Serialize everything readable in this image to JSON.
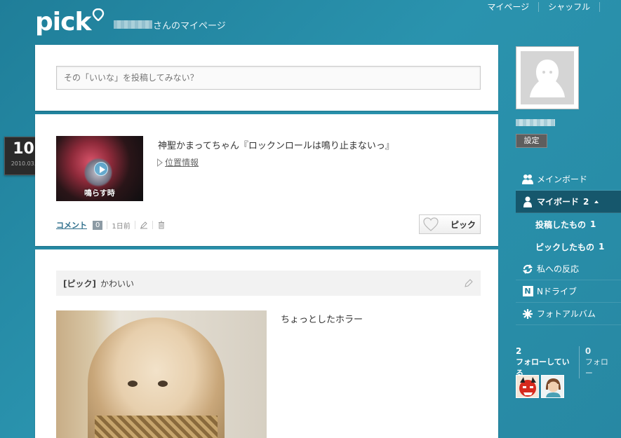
{
  "header": {
    "logo": "pick",
    "page_title": "さんのマイページ",
    "nav": [
      "マイページ",
      "シャッフル"
    ]
  },
  "post_box": {
    "placeholder": "その「いいな」を投稿してみない？"
  },
  "date_badge": {
    "day": "10",
    "year_month": "2010.03."
  },
  "entry1": {
    "title": "神聖かまってちゃん『ロックンロールは鳴り止まないっ』",
    "location_label": "位置情報",
    "thumbnail_caption": "鳴らす時",
    "comment_label": "コメント",
    "comment_count": "0",
    "time_ago": "1日前",
    "pick_label": "ピック"
  },
  "entry2": {
    "tag": "[ピック]",
    "caption": "かわいい",
    "text": "ちょっとしたホラー"
  },
  "sidebar": {
    "settings_label": "設定",
    "menu": [
      {
        "label": "メインボード",
        "icon": "people-icon"
      },
      {
        "label": "マイボード",
        "count": "2",
        "icon": "person-icon",
        "active": true
      },
      {
        "label": "投稿したもの",
        "count": "1",
        "sub": true
      },
      {
        "label": "ピックしたもの",
        "count": "1",
        "sub": true
      },
      {
        "label": "私への反応",
        "icon": "refresh-icon"
      },
      {
        "label": "Nドライブ",
        "icon": "n-drive-icon"
      },
      {
        "label": "フォトアルバム",
        "icon": "photo-album-icon"
      }
    ],
    "follow": {
      "following_count": "2",
      "following_label": "フォローしている",
      "followers_count": "0",
      "followers_label": "フォロー"
    }
  },
  "colors": {
    "background": "#2a93ae",
    "active_menu": "#16576c"
  }
}
